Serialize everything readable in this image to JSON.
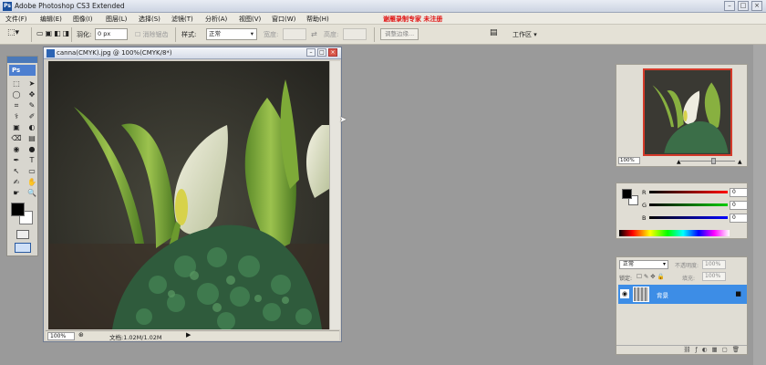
{
  "window": {
    "title": "Adobe Photoshop CS3 Extended",
    "buttons": [
      "–",
      "□",
      "×"
    ]
  },
  "menu": [
    "文件(F)",
    "编辑(E)",
    "图像(I)",
    "图层(L)",
    "选择(S)",
    "滤镜(T)",
    "分析(A)",
    "视图(V)",
    "窗口(W)",
    "帮助(H)"
  ],
  "watermark": "谢雁录制专家 未注册",
  "options": {
    "feather_label": "羽化:",
    "feather_value": "0 px",
    "antialias_label": "消除锯齿",
    "style_label": "样式:",
    "style_value": "正常",
    "width_label": "宽度:",
    "height_label": "高度:",
    "refine_button": "调整边缘...",
    "workspace": "工作区 ▾"
  },
  "toolbox": {
    "badge": "Ps",
    "tools": [
      "⬚",
      "➤",
      "◯",
      "✥",
      "⌗",
      "✎",
      "⚕",
      "✐",
      "▣",
      "◐",
      "⌫",
      "▤",
      "◉",
      "●",
      "✒",
      "T",
      "↖",
      "▭",
      "✍",
      "✋",
      "☛",
      "🔍"
    ]
  },
  "document": {
    "title": "canna(CMYK).jpg @ 100%(CMYK/8*)",
    "zoom": "100%",
    "info": "文档:1.02M/1.02M",
    "status_arrow": "▶"
  },
  "navigator": {
    "zoom": "100%"
  },
  "color": {
    "R": "0",
    "G": "0",
    "B": "0"
  },
  "layers": {
    "blend_mode": "正常",
    "opacity_label": "不透明度:",
    "opacity": "100%",
    "lock_label": "锁定:",
    "fill_label": "填充:",
    "fill": "100%",
    "layer_name": "背景"
  }
}
